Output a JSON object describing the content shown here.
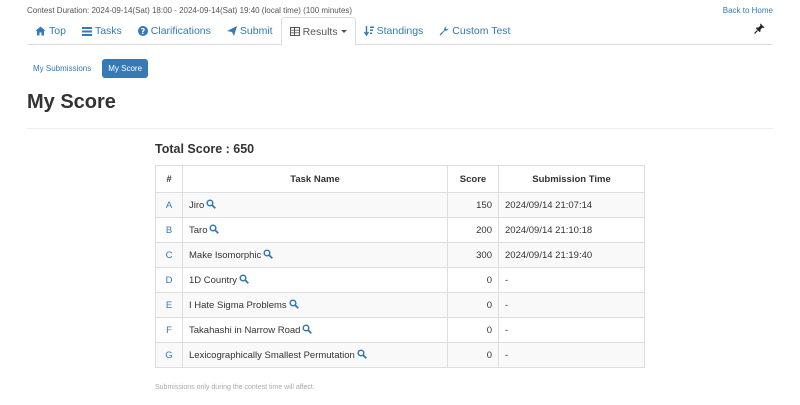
{
  "header": {
    "contest_duration": "Contest Duration: 2024-09-14(Sat) 18:00 - 2024-09-14(Sat) 19:40 (local time) (100 minutes)",
    "back_link": "Back to Home"
  },
  "nav": {
    "items": [
      {
        "label": "Top",
        "icon": "home-icon"
      },
      {
        "label": "Tasks",
        "icon": "list-icon"
      },
      {
        "label": "Clarifications",
        "icon": "question-circle-icon"
      },
      {
        "label": "Submit",
        "icon": "send-icon"
      },
      {
        "label": "Results",
        "icon": "table-icon",
        "active": true,
        "dropdown": true
      },
      {
        "label": "Standings",
        "icon": "sort-icon"
      },
      {
        "label": "Custom Test",
        "icon": "wrench-icon"
      }
    ],
    "pin_icon": "pushpin-icon"
  },
  "subnav": {
    "items": [
      {
        "label": "My Submissions",
        "active": false
      },
      {
        "label": "My Score",
        "active": true
      }
    ]
  },
  "page": {
    "title": "My Score",
    "total_label": "Total Score : 650"
  },
  "table": {
    "headers": [
      "#",
      "Task Name",
      "Score",
      "Submission Time"
    ],
    "rows": [
      {
        "letter": "A",
        "name": "Jiro",
        "score": "150",
        "time": "2024/09/14 21:07:14"
      },
      {
        "letter": "B",
        "name": "Taro",
        "score": "200",
        "time": "2024/09/14 21:10:18"
      },
      {
        "letter": "C",
        "name": "Make Isomorphic",
        "score": "300",
        "time": "2024/09/14 21:19:40"
      },
      {
        "letter": "D",
        "name": "1D Country",
        "score": "0",
        "time": "-"
      },
      {
        "letter": "E",
        "name": "I Hate Sigma Problems",
        "score": "0",
        "time": "-"
      },
      {
        "letter": "F",
        "name": "Takahashi in Narrow Road",
        "score": "0",
        "time": "-"
      },
      {
        "letter": "G",
        "name": "Lexicographically Smallest Permutation",
        "score": "0",
        "time": "-"
      }
    ]
  },
  "footer_note": "Submissions only during the contest time will affect.",
  "colors": {
    "link": "#337ab7",
    "active_pill_bg": "#337ab7",
    "border": "#dddddd"
  }
}
